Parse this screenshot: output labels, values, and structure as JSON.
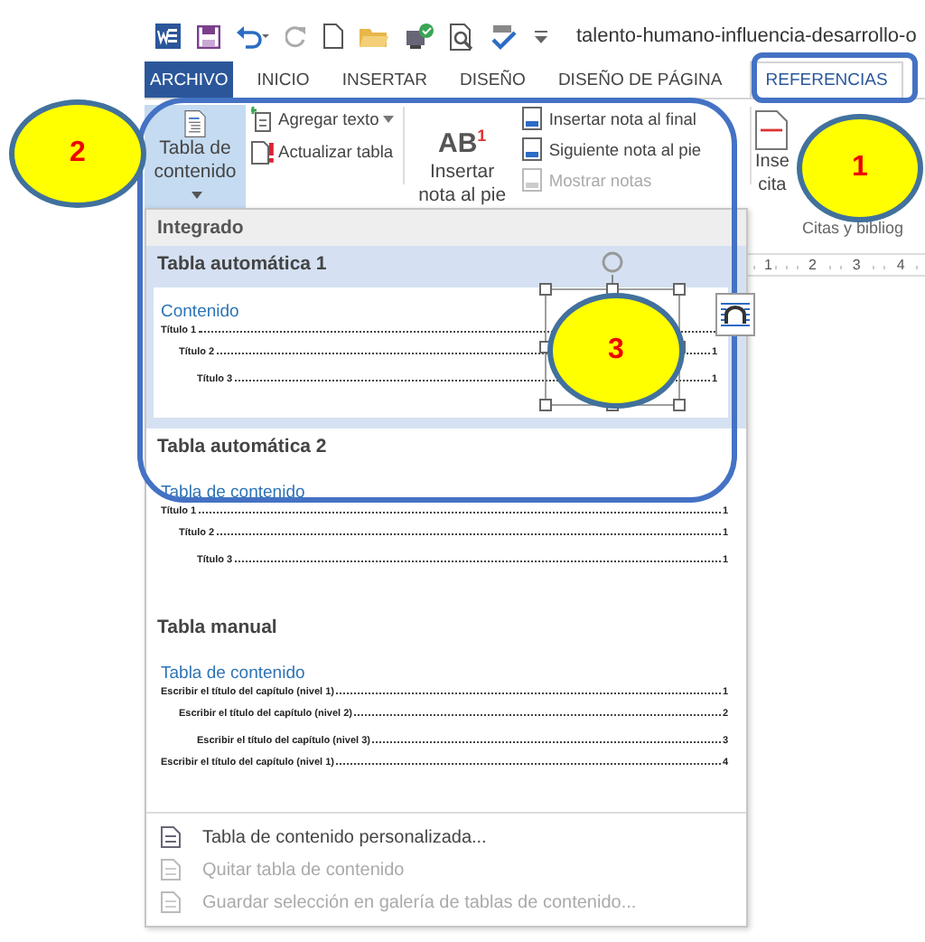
{
  "title_bar": {
    "document_title": "talento-humano-influencia-desarrollo-o"
  },
  "tabs": [
    {
      "label": "ARCHIVO",
      "kind": "file",
      "selected": false
    },
    {
      "label": "INICIO",
      "kind": "tab",
      "selected": false
    },
    {
      "label": "INSERTAR",
      "kind": "tab",
      "selected": false
    },
    {
      "label": "DISEÑO",
      "kind": "tab",
      "selected": false
    },
    {
      "label": "DISEÑO DE PÁGINA",
      "kind": "tab",
      "selected": false
    },
    {
      "label": "REFERENCIAS",
      "kind": "tab",
      "selected": true
    }
  ],
  "ribbon": {
    "toc_button": {
      "label": "Tabla de contenido",
      "expanded": true
    },
    "toc_commands": [
      {
        "label": "Agregar texto",
        "dropdown": true
      },
      {
        "label": "Actualizar tabla",
        "dropdown": false
      }
    ],
    "footnote_button": {
      "icon_text": "AB$^{1}$",
      "label": "Insertar nota al pie"
    },
    "footnote_commands": [
      {
        "label": "Insertar nota al final",
        "disabled": false
      },
      {
        "label": "Siguiente nota al pie",
        "disabled": false
      },
      {
        "label": "Mostrar notas",
        "disabled": true
      }
    ],
    "citation_button": {
      "label_lines": [
        "Inse",
        "cita"
      ]
    },
    "group_label": "Citas y bibliog"
  },
  "ruler": {
    "numbers": [
      "1",
      "2",
      "3",
      "4"
    ]
  },
  "gallery": {
    "section_header": "Integrado",
    "entries": [
      {
        "title": "Tabla automática 1",
        "selected": true,
        "heading": "Contenido",
        "lines": [
          {
            "text": "Título 1",
            "children": [
              {
                "text": "Título 2",
                "page": "1",
                "children": [
                  {
                    "text": "Título 3",
                    "page": "1"
                  }
                ]
              }
            ]
          }
        ]
      },
      {
        "title": "Tabla automática 2",
        "selected": false,
        "heading": "Tabla de contenido",
        "lines": [
          {
            "text": "Título 1",
            "page": "1",
            "children": [
              {
                "text": "Título 2",
                "page": "1",
                "children": [
                  {
                    "text": "Título 3",
                    "page": "1"
                  }
                ]
              }
            ]
          }
        ]
      },
      {
        "title": "Tabla manual",
        "selected": false,
        "heading": "Tabla de contenido",
        "lines": [
          {
            "text": "Escribir el título del capítulo (nivel 1)",
            "page": "1",
            "children": [
              {
                "text": "Escribir el título del capítulo (nivel 2)",
                "page": "2",
                "children": [
                  {
                    "text": "Escribir el título del capítulo (nivel 3)",
                    "page": "3"
                  }
                ]
              }
            ]
          },
          {
            "text": "Escribir el título del capítulo (nivel 1)",
            "page": "4"
          }
        ]
      }
    ],
    "commands": [
      {
        "label": "Tabla de contenido personalizada...",
        "disabled": false
      },
      {
        "label": "Quitar tabla de contenido",
        "disabled": true
      },
      {
        "label": "Guardar selección en galería de tablas de contenido...",
        "disabled": true
      }
    ]
  },
  "annotations": [
    {
      "number": "2"
    },
    {
      "number": "1"
    },
    {
      "number": "3"
    }
  ]
}
